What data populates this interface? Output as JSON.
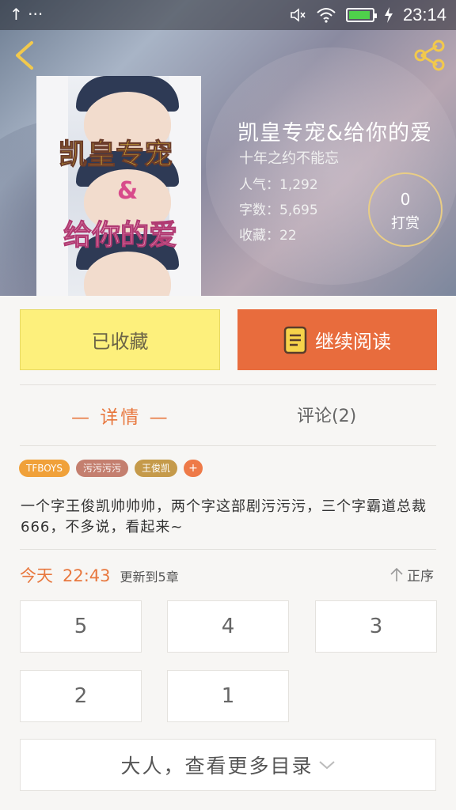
{
  "status_bar": {
    "left_icons": "↑ ···",
    "time": "23:14"
  },
  "book": {
    "title": "凯皇专宠&给你的爱",
    "subtitle": "十年之约不能忘",
    "popularity": "人气：1,292",
    "word_count": "字数：5,695",
    "favorites": "收藏：22",
    "cover_lines": [
      "凯皇专宠",
      "&",
      "给你的爱"
    ]
  },
  "tip": {
    "count": "0",
    "label": "打赏"
  },
  "actions": {
    "favorited_label": "已收藏",
    "continue_label": "继续阅读"
  },
  "tabs": {
    "details": "— 详情 —",
    "comments": "评论(2)"
  },
  "tags": [
    {
      "label": "TFBOYS",
      "color": "#f0a13a"
    },
    {
      "label": "污污污污",
      "color": "#c47f6f"
    },
    {
      "label": "王俊凯",
      "color": "#c59a4a"
    },
    {
      "label": "+",
      "color": "#ee7a48"
    }
  ],
  "description": "一个字王俊凯帅帅帅，两个字这部剧污污污，三个字霸道总裁666，不多说，看起来~",
  "update": {
    "day": "今天",
    "time": "22:43",
    "count_text": "更新到5章",
    "order_label": "正序"
  },
  "chapters": [
    "5",
    "4",
    "3",
    "2",
    "1"
  ],
  "more_label": "大人，查看更多目录",
  "colors": {
    "accent": "#e8783f",
    "read_button": "#e86c3d",
    "fav_button": "#fdf07c",
    "tip_ring": "#e9cd85"
  },
  "icons": [
    "back-icon",
    "share-icon",
    "mute-icon",
    "wifi-icon",
    "battery-icon",
    "book-icon",
    "up-arrow-icon",
    "chevron-down-icon"
  ]
}
